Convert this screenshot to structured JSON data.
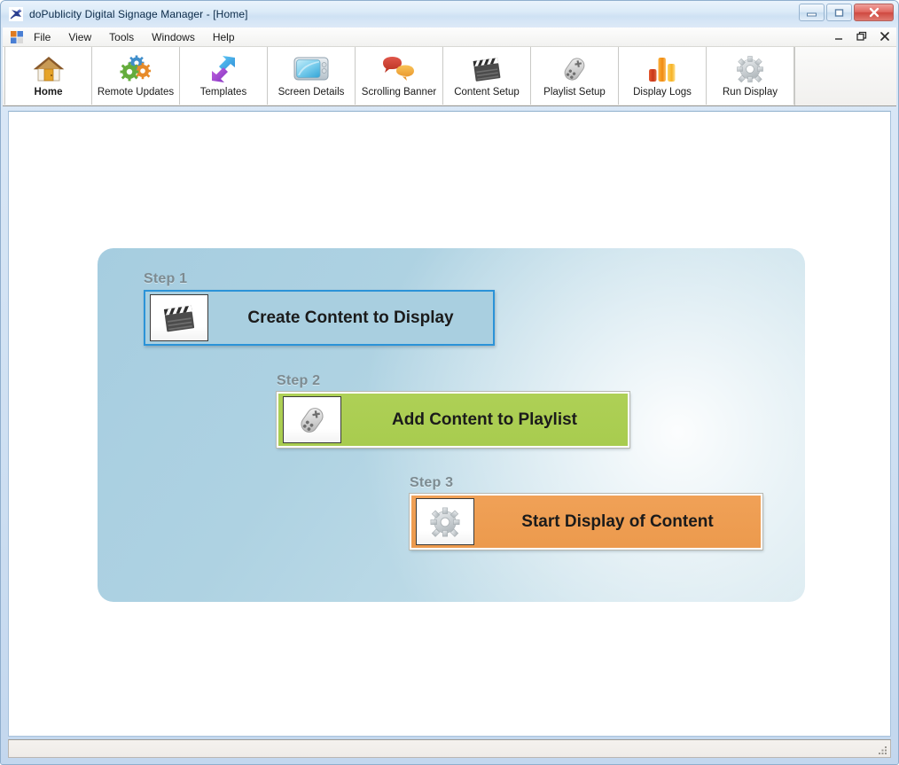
{
  "window": {
    "title": "doPublicity Digital Signage Manager - [Home]",
    "app_icon": "app-logo-icon",
    "controls": {
      "minimize_label": "Minimize",
      "maximize_label": "Maximize",
      "close_label": "Close"
    }
  },
  "menubar": {
    "system_icon": "mdi-system-icon",
    "items": [
      {
        "label": "File"
      },
      {
        "label": "View"
      },
      {
        "label": "Tools"
      },
      {
        "label": "Windows"
      },
      {
        "label": "Help"
      }
    ],
    "mdi_controls": {
      "minimize_label": "Minimize Document",
      "restore_label": "Restore Document",
      "close_label": "Close Document"
    }
  },
  "toolbar": {
    "buttons": [
      {
        "label": "Home",
        "icon": "house-icon",
        "active": true
      },
      {
        "label": "Remote Updates",
        "icon": "gears-icon",
        "active": false
      },
      {
        "label": "Templates",
        "icon": "arrows-swap-icon",
        "active": false
      },
      {
        "label": "Screen Details",
        "icon": "television-icon",
        "active": false
      },
      {
        "label": "Scrolling Banner",
        "icon": "speech-bubbles-icon",
        "active": false
      },
      {
        "label": "Content Setup",
        "icon": "clapperboard-icon",
        "active": false
      },
      {
        "label": "Playlist Setup",
        "icon": "game-remote-icon",
        "active": false
      },
      {
        "label": "Display Logs",
        "icon": "bar-chart-icon",
        "active": false
      },
      {
        "label": "Run Display",
        "icon": "gear-icon",
        "active": false
      }
    ]
  },
  "home": {
    "steps": [
      {
        "step_label": "Step 1",
        "action_label": "Create Content to Display",
        "icon": "clapperboard-icon",
        "accent_color": "#a9cfe0",
        "border_color": "#2b93d8"
      },
      {
        "step_label": "Step 2",
        "action_label": "Add Content to Playlist",
        "icon": "game-remote-icon",
        "accent_color": "#aed056",
        "border_color": "#ffffff"
      },
      {
        "step_label": "Step 3",
        "action_label": "Start Display of Content",
        "icon": "gear-icon",
        "accent_color": "#f0a157",
        "border_color": "#ffffff"
      }
    ]
  },
  "statusbar": {
    "text": "",
    "grip_icon": "resize-grip-icon"
  }
}
